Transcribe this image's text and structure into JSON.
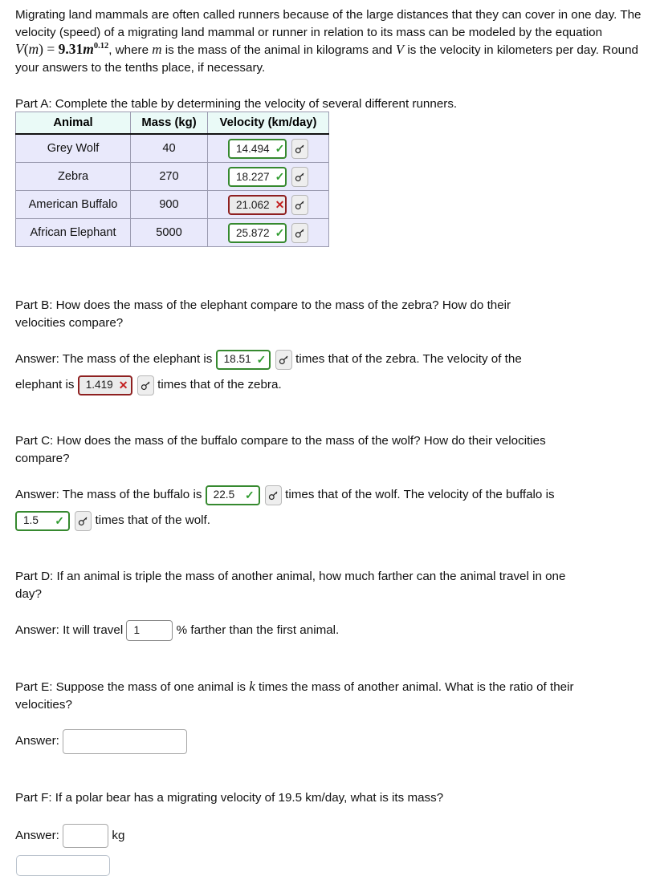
{
  "intro": {
    "segment1": "Migrating land mammals are often called runners because of the large distances that they can cover in one day. The velocity (speed) of a migrating land mammal or runner in relation to its mass can be modeled by the equation ",
    "equation": {
      "fn": "V",
      "open": "(",
      "arg": "m",
      "close": ")",
      "equals": "=",
      "coefficient": "9.31",
      "base": "m",
      "exponent": "0.12"
    },
    "segment2": ", where ",
    "var_m": "m",
    "segment3": " is the mass of the animal in kilograms and ",
    "var_V": "V",
    "segment4": " is the velocity in kilometers per day. Round your answers to the tenths place, if necessary."
  },
  "partA": {
    "prompt": "Part A: Complete the table by determining the velocity of several different runners.",
    "table": {
      "headers": [
        "Animal",
        "Mass (kg)",
        "Velocity (km/day)"
      ],
      "rows": [
        {
          "animal": "Grey Wolf",
          "mass": "40",
          "velocity": "14.494",
          "status": "correct",
          "mark": "✓"
        },
        {
          "animal": "Zebra",
          "mass": "270",
          "velocity": "18.227",
          "status": "correct",
          "mark": "✓"
        },
        {
          "animal": "American Buffalo",
          "mass": "900",
          "velocity": "21.062",
          "status": "incorrect",
          "mark": "✕"
        },
        {
          "animal": "African Elephant",
          "mass": "5000",
          "velocity": "25.872",
          "status": "correct",
          "mark": "✓"
        }
      ]
    },
    "key_icon": "key-icon"
  },
  "partB": {
    "prompt": "Part B: How does the mass of the elephant compare to the mass of the zebra? How do their velocities compare?",
    "answer_prefix": "Answer: The mass of the elephant is",
    "field1": {
      "value": "18.51",
      "status": "correct",
      "mark": "✓"
    },
    "mid_text": "times that of the zebra. The velocity of the",
    "line2_prefix": "elephant is",
    "field2": {
      "value": "1.419",
      "status": "incorrect",
      "mark": "✕"
    },
    "suffix": "times that of the zebra."
  },
  "partC": {
    "prompt": "Part C: How does the mass of the buffalo compare to the mass of the wolf? How do their velocities compare?",
    "answer_prefix": "Answer: The mass of the buffalo is",
    "field1": {
      "value": "22.5",
      "status": "correct",
      "mark": "✓"
    },
    "mid_text": "times that of the wolf. The velocity of the buffalo is",
    "field2": {
      "value": "1.5",
      "status": "correct",
      "mark": "✓"
    },
    "suffix": "times that of the wolf."
  },
  "partD": {
    "prompt": "Part D: If an animal is triple the mass of another animal, how much farther can the animal travel in one day?",
    "answer_prefix": "Answer: It will travel",
    "field": {
      "value": "1",
      "status": "plain"
    },
    "suffix": "% farther than the first animal."
  },
  "partE": {
    "prompt_before_k": "Part E: Suppose the mass of one animal is ",
    "k_symbol": "k",
    "prompt_after_k": " times the mass of another animal. What is the ratio of their velocities?",
    "answer_prefix": "Answer:",
    "field": {
      "value": "",
      "status": "empty"
    }
  },
  "partF": {
    "prompt": "Part F: If a polar bear has a migrating velocity of 19.5 km/day, what is its mass?",
    "answer_prefix": "Answer:",
    "field": {
      "value": "",
      "status": "empty"
    },
    "unit": "kg"
  },
  "colors": {
    "correct_border": "#36892f",
    "correct_mark": "#2f9b2f",
    "incorrect_border": "#8e2020",
    "incorrect_mark": "#c31f1f",
    "table_header_bg": "#eafaf7",
    "table_row_bg": "#e9e9fb"
  }
}
